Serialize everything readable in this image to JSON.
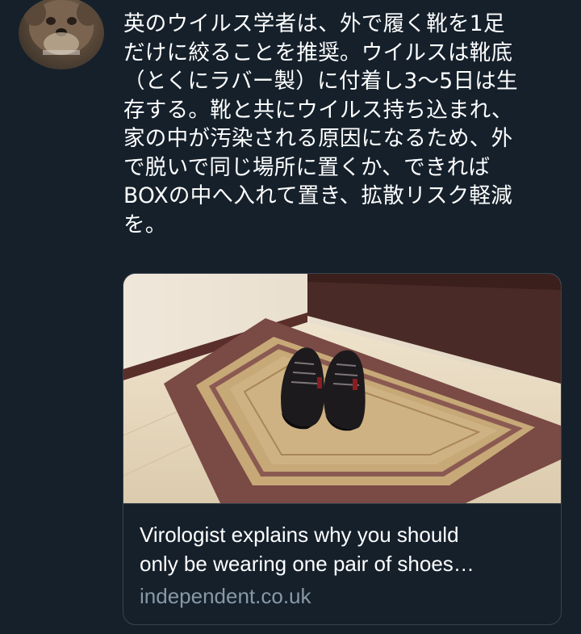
{
  "tweet": {
    "text_lines": [
      "英のウイルス学者は、外で履く靴を1足",
      "だけに絞ることを推奨。ウイルスは靴底",
      "（とくにラバー製）に付着し3〜5日は生",
      "存する。靴と共にウイルス持ち込まれ、",
      "家の中が汚染される原因になるため、外",
      "で脱いで同じ場所に置くか、できれば",
      "BOXの中へ入れて置き、拡散リスク軽減",
      "を。"
    ]
  },
  "link_card": {
    "title_lines": [
      "Virologist explains why you should",
      "only be wearing one pair of shoes…"
    ],
    "domain": "independent.co.uk"
  },
  "colors": {
    "background": "#15202b",
    "text": "#ffffff",
    "secondary_text": "#8899a6",
    "card_border": "#38444d"
  }
}
